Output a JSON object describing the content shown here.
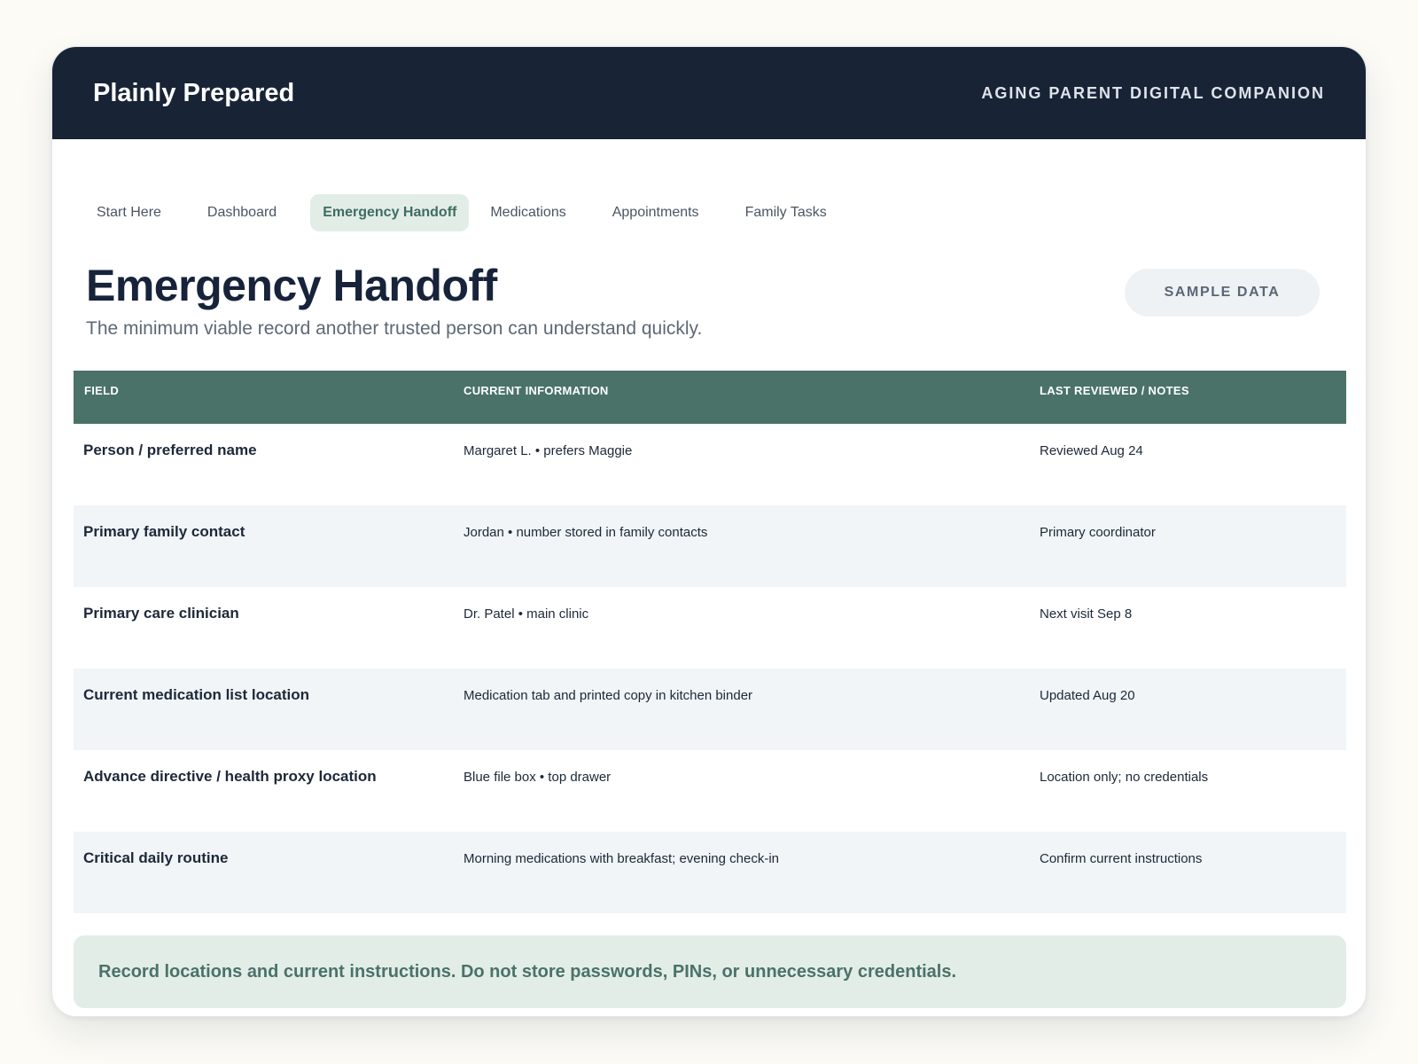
{
  "header": {
    "brand": "Plainly Prepared",
    "tagline": "AGING PARENT DIGITAL COMPANION"
  },
  "tabs": [
    {
      "label": "Start Here",
      "active": false
    },
    {
      "label": "Dashboard",
      "active": false
    },
    {
      "label": "Emergency Handoff",
      "active": true
    },
    {
      "label": "Medications",
      "active": false
    },
    {
      "label": "Appointments",
      "active": false
    },
    {
      "label": "Family Tasks",
      "active": false
    }
  ],
  "page": {
    "title": "Emergency Handoff",
    "subtitle": "The minimum viable record another trusted person can understand quickly.",
    "badge": "SAMPLE DATA"
  },
  "table": {
    "headers": [
      "FIELD",
      "CURRENT INFORMATION",
      "LAST REVIEWED / NOTES"
    ],
    "rows": [
      [
        "Person / preferred name",
        "Margaret L. • prefers Maggie",
        "Reviewed Aug 24"
      ],
      [
        "Primary family contact",
        "Jordan • number stored in family contacts",
        "Primary coordinator"
      ],
      [
        "Primary care clinician",
        "Dr. Patel • main clinic",
        "Next visit Sep 8"
      ],
      [
        "Current medication list location",
        "Medication tab and printed copy in kitchen binder",
        "Updated Aug 20"
      ],
      [
        "Advance directive / health proxy location",
        "Blue file box • top drawer",
        "Location only; no credentials"
      ],
      [
        "Critical daily routine",
        "Morning medications with breakfast; evening check-in",
        "Confirm current instructions"
      ]
    ]
  },
  "notice": "Record locations and current instructions. Do not store passwords, PINs, or unnecessary credentials.",
  "colors": {
    "header_bg": "#182336",
    "accent": "#4a7268",
    "active_tab_bg": "#e3ede8"
  }
}
